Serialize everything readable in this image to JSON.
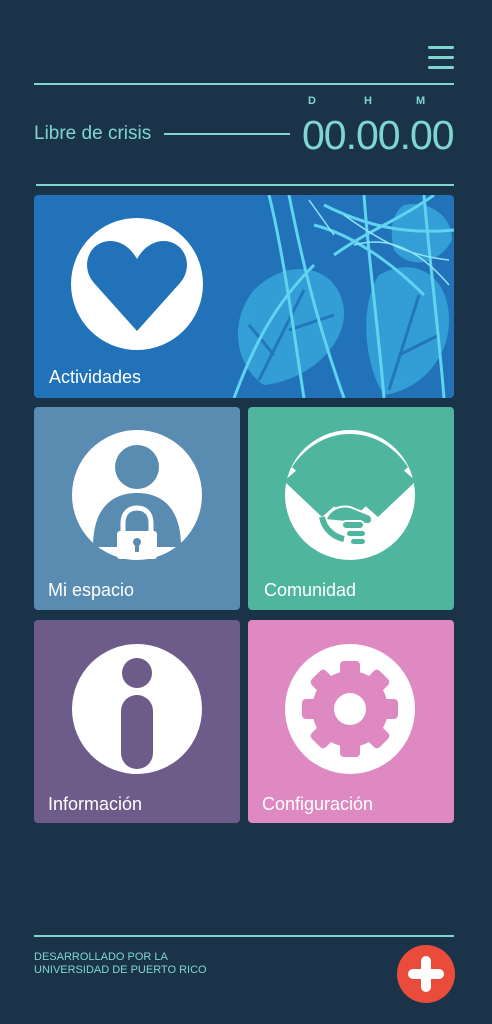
{
  "header": {
    "menu_icon": "hamburger-menu-icon"
  },
  "counter": {
    "label": "Libre de crisis",
    "units": {
      "days": "D",
      "hours": "H",
      "minutes": "M"
    },
    "value": "00.00.00"
  },
  "tiles": [
    {
      "label": "Actividades",
      "icon": "heart-icon",
      "color": "#2172b9"
    },
    {
      "label": "Mi espacio",
      "icon": "person-lock-icon",
      "color": "#5a8cb2"
    },
    {
      "label": "Comunidad",
      "icon": "handshake-icon",
      "color": "#4fb59f"
    },
    {
      "label": "Información",
      "icon": "info-icon",
      "color": "#6d5b8a"
    },
    {
      "label": "Configuración",
      "icon": "gear-icon",
      "color": "#de89c1"
    }
  ],
  "footer": {
    "line1": "DESARROLLADO POR LA",
    "line2": "UNIVERSIDAD DE PUERTO RICO",
    "add_icon": "plus-icon",
    "accent": "#ea4c3c"
  }
}
